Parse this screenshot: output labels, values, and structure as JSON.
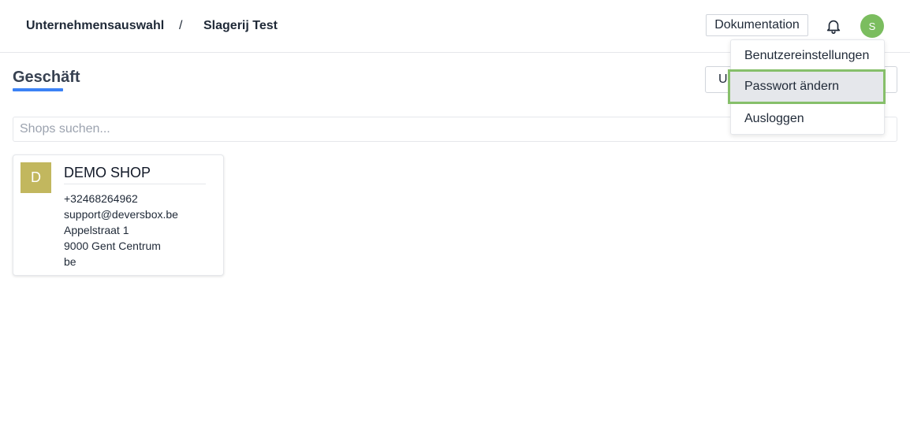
{
  "header": {
    "breadcrumb": [
      "Unternehmensauswahl",
      "/",
      "Slagerij Test"
    ],
    "documentation_label": "Dokumentation",
    "avatar_initial": "S"
  },
  "page": {
    "title": "Geschäft",
    "side_button_label": "U",
    "search_placeholder": "Shops suchen..."
  },
  "shop": {
    "initial": "D",
    "name": "DEMO SHOP",
    "phone": "+32468264962",
    "email": "support@deversbox.be",
    "street": "Appelstraat 1",
    "city": "9000 Gent Centrum",
    "country": "be"
  },
  "user_menu": {
    "items": [
      "Benutzereinstellungen",
      "Passwort ändern",
      "Ausloggen"
    ],
    "highlighted_item": "Passwort ändern"
  },
  "colors": {
    "accent_underline": "#3b82f6",
    "user_avatar": "#7bbd5f",
    "shop_avatar": "#c2b75e",
    "highlight_border": "#86bf6a",
    "highlight_bg": "#e5e7eb"
  },
  "icons": {
    "notifications": "bell-icon"
  }
}
